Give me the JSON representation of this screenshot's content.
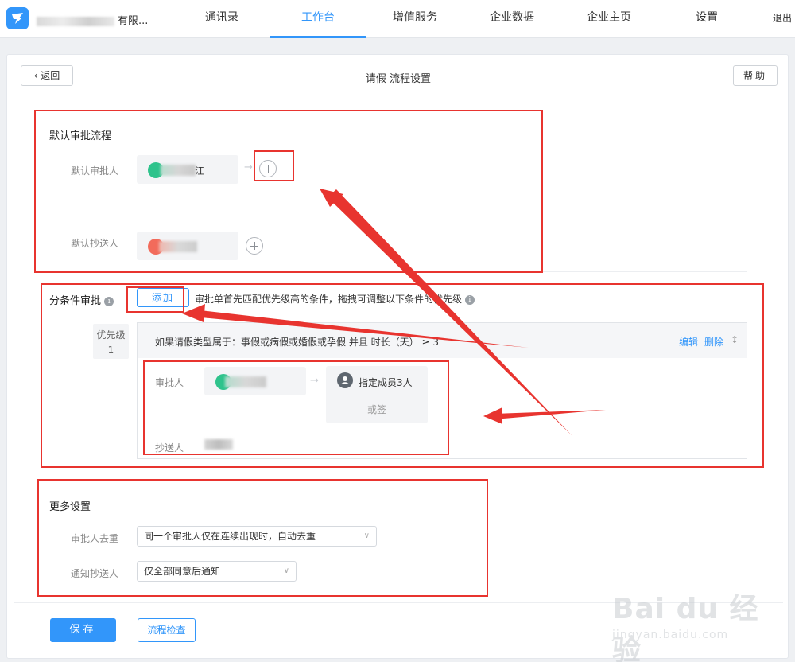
{
  "nav": {
    "company_suffix": "有限...",
    "items": [
      "通讯录",
      "工作台",
      "增值服务",
      "企业数据",
      "企业主页",
      "设置"
    ],
    "active_index": 1,
    "logout": "退出"
  },
  "header": {
    "back_label": "返回",
    "title": "请假 流程设置",
    "help_label": "帮助"
  },
  "default_flow": {
    "title": "默认审批流程",
    "approver_label": "默认审批人",
    "approver_suffix": "江",
    "cc_label": "默认抄送人"
  },
  "conditional": {
    "title": "分条件审批",
    "add_label": "添加",
    "description": "审批单首先匹配优先级高的条件，拖拽可调整以下条件的优先级",
    "priority_label": "优先级",
    "priority_value": "1",
    "condition_text": "如果请假类型属于：事假或病假或婚假或孕假 并且 时长（天） ≥ 3",
    "edit_label": "编辑",
    "delete_label": "删除",
    "approver_label": "审批人",
    "assign_label": "指定成员3人",
    "assign_mode": "或签",
    "cc_label": "抄送人"
  },
  "more": {
    "title": "更多设置",
    "dedup_label": "审批人去重",
    "dedup_value": "同一个审批人仅在连续出现时，自动去重",
    "notify_label": "通知抄送人",
    "notify_value": "仅全部同意后通知"
  },
  "footer": {
    "save_label": "保存",
    "check_label": "流程检查"
  },
  "watermark": {
    "main": "Bai du 经验",
    "sub": "jingyan.baidu.com"
  },
  "colors": {
    "accent": "#3296fa",
    "annotation": "#e8342f",
    "avatar_green": "#2fc38c",
    "avatar_red": "#f26b5b"
  }
}
